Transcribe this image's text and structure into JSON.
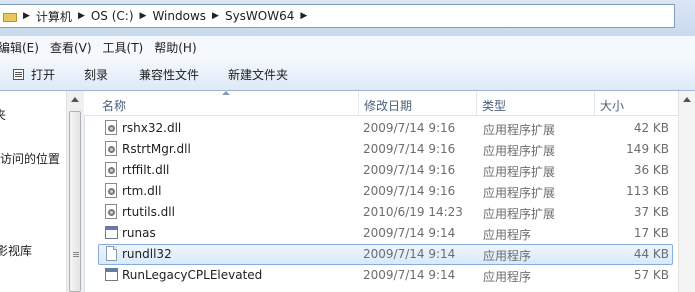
{
  "address_bar": {
    "breadcrumbs": [
      "计算机",
      "OS (C:)",
      "Windows",
      "SysWOW64"
    ]
  },
  "menu": {
    "items": [
      "编辑(E)",
      "查看(V)",
      "工具(T)",
      "帮助(H)"
    ]
  },
  "toolbar": {
    "open_label": "打开",
    "burn_label": "刻录",
    "compat_label": "兼容性文件",
    "new_folder_label": "新建文件夹"
  },
  "nav_pane": {
    "items": [
      "夹",
      "访问的位置",
      "影视库"
    ]
  },
  "columns": {
    "name": "名称",
    "date": "修改日期",
    "type": "类型",
    "size": "大小"
  },
  "files": [
    {
      "name": "rshx32.dll",
      "date": "2009/7/14 9:16",
      "type": "应用程序扩展",
      "size": "42 KB",
      "icon": "dll-icon"
    },
    {
      "name": "RstrtMgr.dll",
      "date": "2009/7/14 9:16",
      "type": "应用程序扩展",
      "size": "149 KB",
      "icon": "dll-icon"
    },
    {
      "name": "rtffilt.dll",
      "date": "2009/7/14 9:16",
      "type": "应用程序扩展",
      "size": "36 KB",
      "icon": "dll-icon"
    },
    {
      "name": "rtm.dll",
      "date": "2009/7/14 9:16",
      "type": "应用程序扩展",
      "size": "113 KB",
      "icon": "dll-icon"
    },
    {
      "name": "rtutils.dll",
      "date": "2010/6/19 14:23",
      "type": "应用程序扩展",
      "size": "37 KB",
      "icon": "dll-icon"
    },
    {
      "name": "runas",
      "date": "2009/7/14 9:14",
      "type": "应用程序",
      "size": "17 KB",
      "icon": "exe-icon"
    },
    {
      "name": "rundll32",
      "date": "2009/7/14 9:14",
      "type": "应用程序",
      "size": "44 KB",
      "icon": "blank-file-icon",
      "selected": true
    },
    {
      "name": "RunLegacyCPLElevated",
      "date": "2009/7/14 9:14",
      "type": "应用程序",
      "size": "57 KB",
      "icon": "exe-icon"
    }
  ]
}
